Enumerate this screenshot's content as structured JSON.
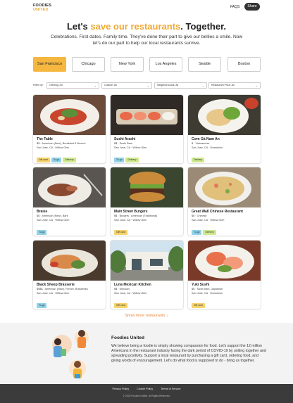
{
  "brand": {
    "line1": "FOODIES",
    "line2": "UNITED"
  },
  "nav": {
    "faqs": "FAQS",
    "share": "Share"
  },
  "hero": {
    "headline_pre": "Let's ",
    "headline_highlight": "save our restaurants",
    "headline_post": ". Together.",
    "intro": "Celebrations. First dates. Family time. They've done their part to give our bellies a smile. Now let's do our part to help our local restaurants survive."
  },
  "cities": [
    "San Francisco",
    "Chicago",
    "New York",
    "Los Angeles",
    "Seattle",
    "Boston"
  ],
  "active_city": "San Francisco",
  "filters": {
    "label": "Filter by:",
    "selects": [
      {
        "label": "Offering:",
        "value": "All"
      },
      {
        "label": "Cuisine:",
        "value": "All"
      },
      {
        "label": "Neighborhoods:",
        "value": "All"
      },
      {
        "label": "Restaurant Price:",
        "value": "All"
      }
    ]
  },
  "restaurants": [
    {
      "name": "The Table",
      "category": "$$ · American (New), Breakfast & Brunch",
      "location": "San Jose, CA · Willow Glen",
      "tags": [
        "Gift card",
        "To-go",
        "Delivery"
      ]
    },
    {
      "name": "Sushi Arashi",
      "category": "$$ · Sushi Bars",
      "location": "San Jose, CA · Willow Glen",
      "tags": [
        "To-go",
        "Delivery"
      ]
    },
    {
      "name": "Cơm Gà Nam An",
      "category": "$ · Vietnamese",
      "location": "San Jose, CA · Downtown",
      "tags": [
        "Delivery"
      ]
    },
    {
      "name": "Braise",
      "category": "$$ · American (New), Bars",
      "location": "San Jose, CA · Willow Glen",
      "tags": [
        "To-go"
      ]
    },
    {
      "name": "Main Street Burgers",
      "category": "$$ · Burgers · American (Traditional)",
      "location": "San Jose, CA · Willow Glen",
      "tags": [
        "Gift card"
      ]
    },
    {
      "name": "Great Wall Chinese Restaurant",
      "category": "$$ · Chinese",
      "location": "San Jose, CA · Willow Glen",
      "tags": [
        "To-go",
        "Delivery"
      ]
    },
    {
      "name": "Black Sheep Brasserie",
      "category": "$$$$ · American (New), French, Brasseries",
      "location": "San Jose, CA · Willow Glen",
      "tags": [
        "To-go"
      ]
    },
    {
      "name": "Luna Mexican Kitchen",
      "category": "$$ · Mexican",
      "location": "San Jose, CA · Willow Glen",
      "tags": [
        "Gift card"
      ]
    },
    {
      "name": "Yuki Sushi",
      "category": "$$ · Sushi bars, Japanese",
      "location": "San Jose, CA · Downtown",
      "tags": [
        "Gift card"
      ]
    }
  ],
  "show_more": "Show more restaurants ↓",
  "about": {
    "title": "Foodies United",
    "text": "We believe being a foodie is simply showing compassion for food. Let's support the 12 million Americans in the restaurant industry facing the dark period of COVID-19 by uniting together and spreading positivity. Support a local restaurant by purchasing a gift card, ordering food, and giving words of encouragement. Let's do what food is supposed to do - bring us together."
  },
  "footer": {
    "links": [
      "Privacy Policy",
      "Cookie Policy",
      "Terms of Service"
    ],
    "copyright": "© 2020 Foodies United. All Rights Reserved."
  },
  "colors": {
    "accent": "#f0a830",
    "active_city": "#f5b740",
    "gift": "#f5d36b",
    "togo": "#8fd3e8",
    "delivery": "#cfe98e",
    "footer": "#3b3b3b"
  }
}
